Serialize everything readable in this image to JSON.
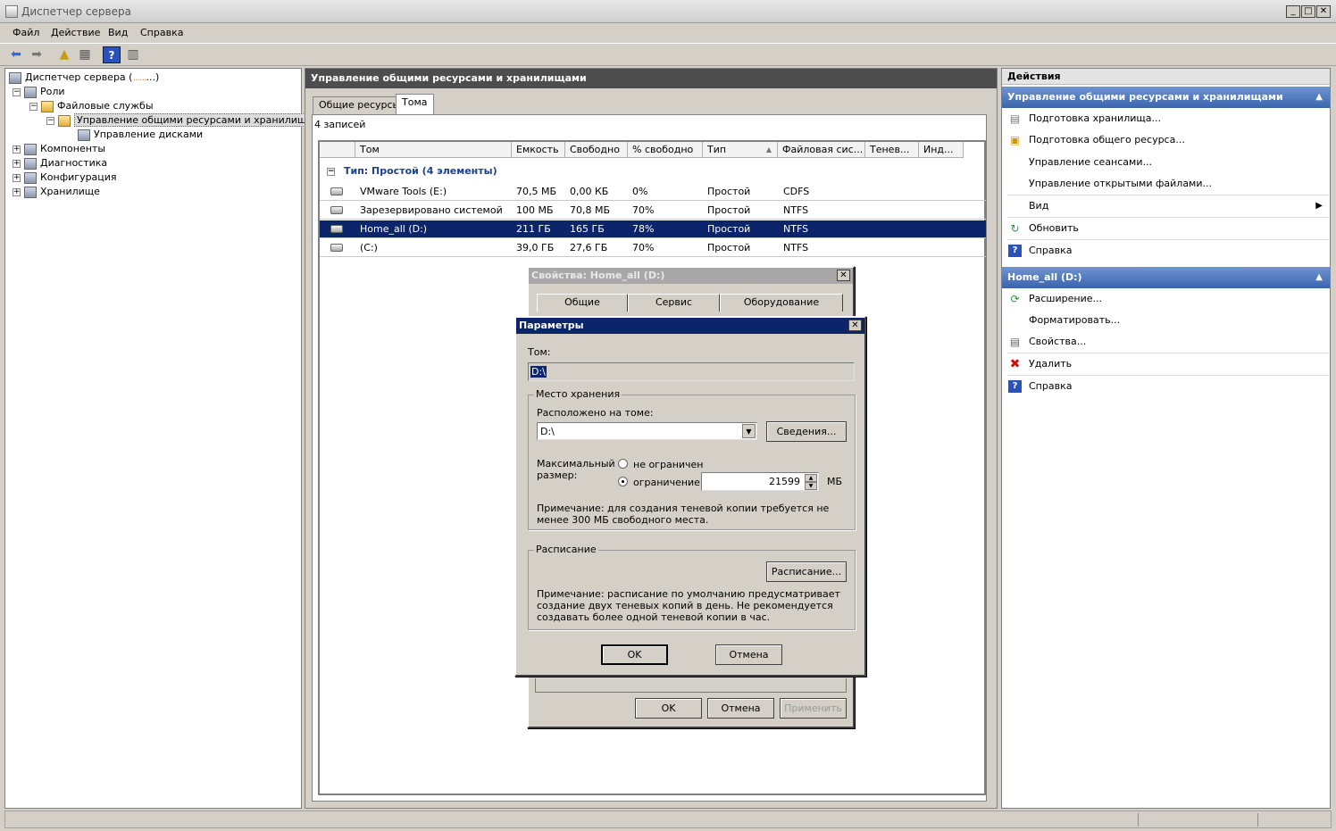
{
  "window": {
    "title": "Диспетчер сервера"
  },
  "menu": [
    "Файл",
    "Действие",
    "Вид",
    "Справка"
  ],
  "tree": {
    "root": "Диспетчер сервера (",
    "root_suffix": "...)",
    "roles": "Роли",
    "file_services": "Файловые службы",
    "share_storage": "Управление общими ресурсами и хранилищами",
    "disk_mgmt": "Управление дисками",
    "components": "Компоненты",
    "diagnostics": "Диагностика",
    "configuration": "Конфигурация",
    "storage": "Хранилище"
  },
  "center": {
    "header": "Управление общими ресурсами и хранилищами",
    "tabs": [
      "Общие ресурсы",
      "Тома"
    ],
    "records": "4 записей",
    "columns": [
      "Том",
      "Емкость",
      "Свободно",
      "% свободно",
      "Тип",
      "Файловая сис...",
      "Тенев...",
      "Инд..."
    ],
    "group": "Тип: Простой (4 элементы)",
    "rows": [
      {
        "name": "VMware Tools (E:)",
        "capacity": "70,5 МБ",
        "free": "0,00 КБ",
        "pct": "0%",
        "type": "Простой",
        "fs": "CDFS"
      },
      {
        "name": "Зарезервировано системой",
        "capacity": "100 МБ",
        "free": "70,8 МБ",
        "pct": "70%",
        "type": "Простой",
        "fs": "NTFS"
      },
      {
        "name": "Home_all (D:)",
        "capacity": "211 ГБ",
        "free": "165 ГБ",
        "pct": "78%",
        "type": "Простой",
        "fs": "NTFS"
      },
      {
        "name": "(C:)",
        "capacity": "39,0 ГБ",
        "free": "27,6 ГБ",
        "pct": "70%",
        "type": "Простой",
        "fs": "NTFS"
      }
    ]
  },
  "actions": {
    "header": "Действия",
    "section1": "Управление общими ресурсами и хранилищами",
    "items1": [
      "Подготовка хранилища...",
      "Подготовка общего ресурса...",
      "Управление сеансами...",
      "Управление открытыми файлами...",
      "Вид",
      "Обновить",
      "Справка"
    ],
    "section2": "Home_all (D:)",
    "items2": [
      "Расширение...",
      "Форматировать...",
      "Свойства...",
      "Удалить",
      "Справка"
    ]
  },
  "props_dialog": {
    "title": "Свойства: Home_all (D:)",
    "tabs": [
      "Общие",
      "Сервис",
      "Оборудование"
    ],
    "ok": "OK",
    "cancel": "Отмена",
    "apply": "Применить"
  },
  "params_dialog": {
    "title": "Параметры",
    "volume_label": "Том:",
    "volume_value": "D:\\",
    "storage_group": "Место хранения",
    "located_on": "Расположено на томе:",
    "located_value": "D:\\",
    "details_btn": "Сведения...",
    "max_size_label": "Максимальный размер:",
    "unlimited": "не ограничен",
    "limit": "ограничение:",
    "limit_value": "21599",
    "unit": "МБ",
    "note1": "Примечание: для создания теневой копии требуется не менее 300 МБ свободного места.",
    "schedule_group": "Расписание",
    "schedule_btn": "Расписание...",
    "note2": "Примечание: расписание по умолчанию предусматривает создание двух теневых копий в день. Не рекомендуется создавать более одной теневой копии в час.",
    "ok": "OK",
    "cancel": "Отмена"
  }
}
